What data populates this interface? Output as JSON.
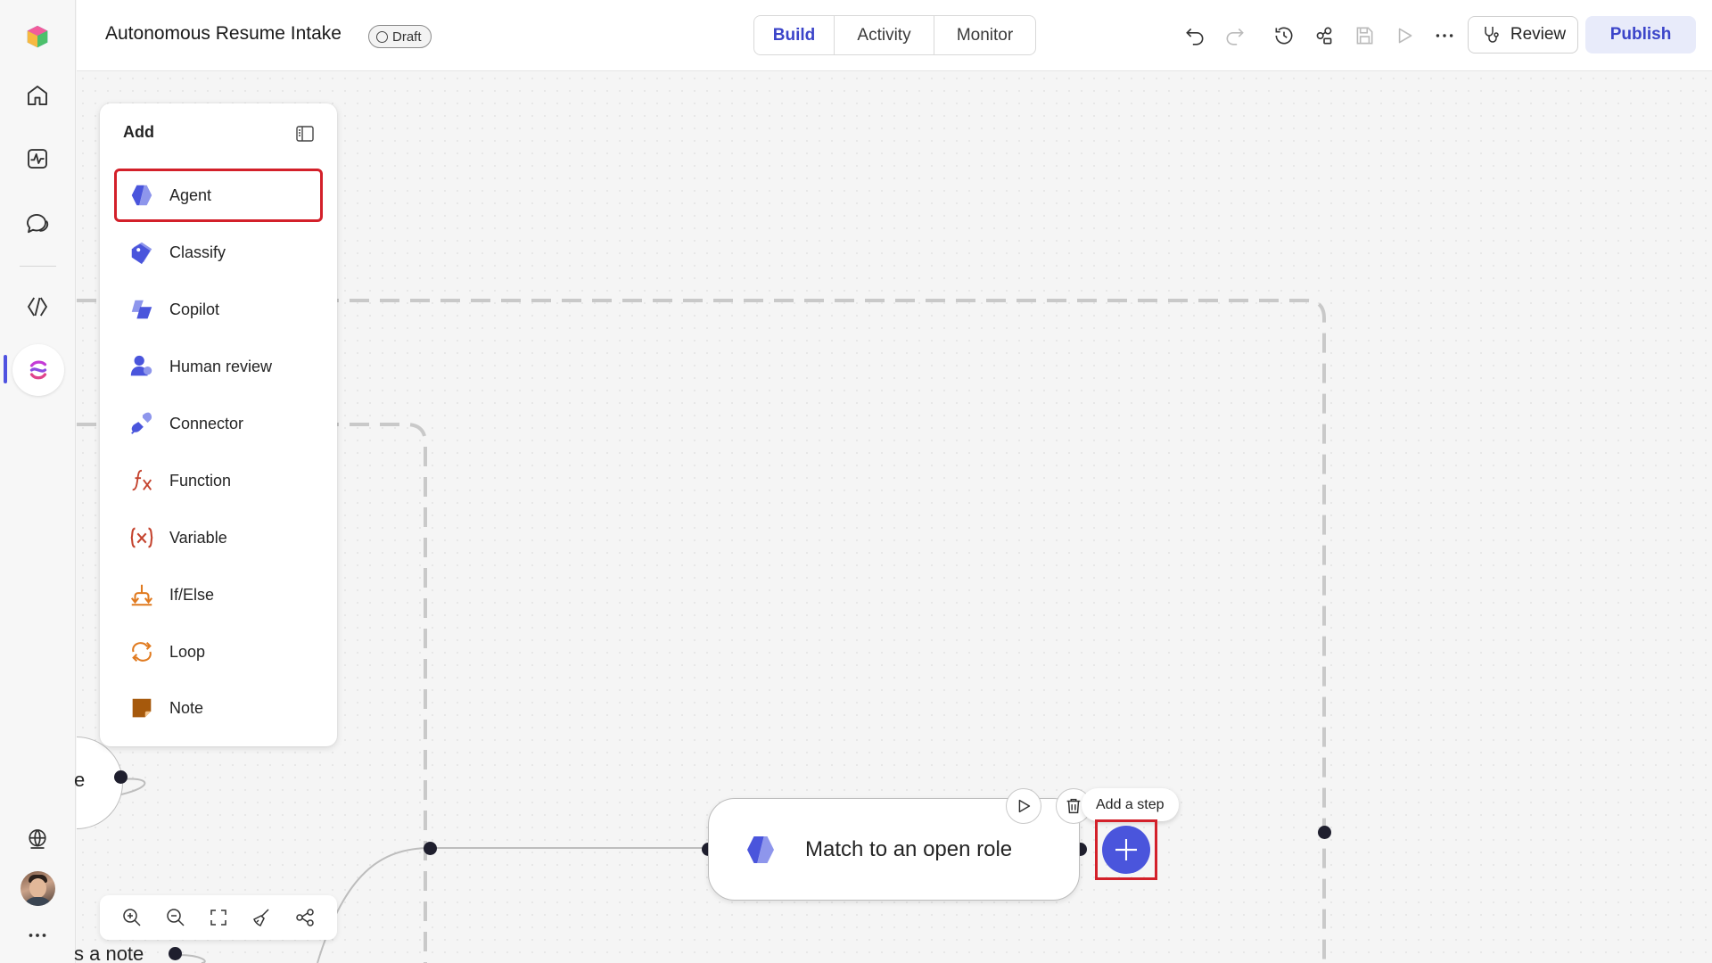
{
  "header": {
    "title": "Autonomous Resume Intake",
    "status_badge": "Draft",
    "tabs": [
      {
        "label": "Build",
        "active": true
      },
      {
        "label": "Activity",
        "active": false
      },
      {
        "label": "Monitor",
        "active": false
      }
    ],
    "review_label": "Review",
    "publish_label": "Publish"
  },
  "add_panel": {
    "title": "Add",
    "items": [
      {
        "label": "Agent",
        "icon": "agent-icon",
        "selected": true
      },
      {
        "label": "Classify",
        "icon": "tag-icon"
      },
      {
        "label": "Copilot",
        "icon": "copilot-icon"
      },
      {
        "label": "Human review",
        "icon": "person-icon"
      },
      {
        "label": "Connector",
        "icon": "plug-icon"
      },
      {
        "label": "Function",
        "icon": "function-icon"
      },
      {
        "label": "Variable",
        "icon": "variable-icon"
      },
      {
        "label": "If/Else",
        "icon": "branch-icon"
      },
      {
        "label": "Loop",
        "icon": "loop-icon"
      },
      {
        "label": "Note",
        "icon": "note-icon"
      }
    ]
  },
  "canvas": {
    "node_title": "Match to an open role",
    "tooltip": "Add a step",
    "partial_node_text": "e",
    "partial_bottom_text": "s a note"
  },
  "colors": {
    "accent": "#4a55dc",
    "highlight": "#d3202a",
    "publish_bg": "#e8ebfa"
  }
}
